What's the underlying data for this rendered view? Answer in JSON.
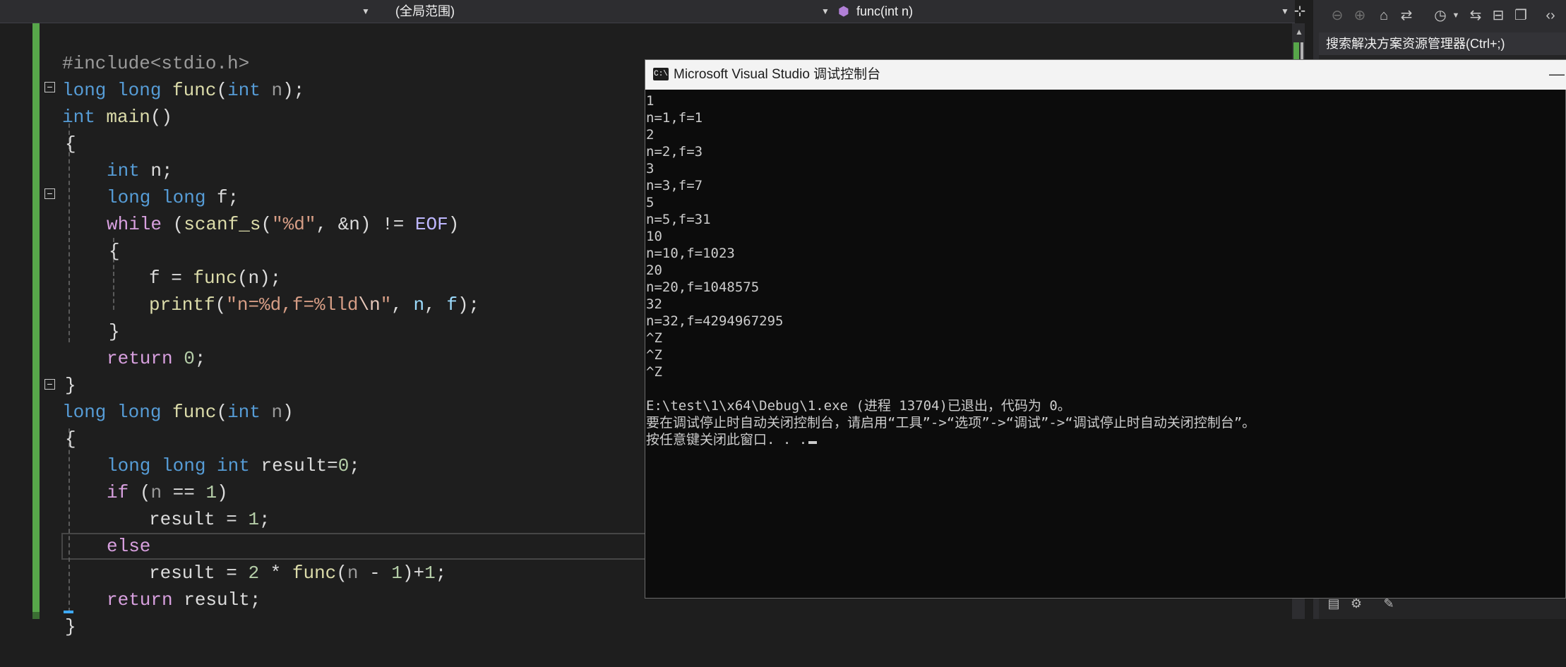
{
  "navbar": {
    "scope_dropdown": "(全局范围)",
    "member_dropdown": "func(int n)"
  },
  "code": {
    "lines": [
      [
        "#include<stdio.h>"
      ],
      [
        "long",
        " long",
        " func",
        "(",
        "int",
        " n",
        ");"
      ],
      [
        "int",
        " main",
        "()"
      ],
      [
        "{"
      ],
      [
        "int",
        " n",
        ";"
      ],
      [
        "long",
        " long",
        " f",
        ";"
      ],
      [
        "while",
        " (",
        "scanf_s",
        "(",
        "\"%d\"",
        ", &",
        "n",
        ") != ",
        "EOF",
        ")"
      ],
      [
        "{"
      ],
      [
        "f",
        " = ",
        "func",
        "(",
        "n",
        ");"
      ],
      [
        "printf",
        "(",
        "\"n=%d,f=%lld",
        "\\n",
        "\"",
        ", ",
        "n",
        ", ",
        "f",
        ");"
      ],
      [
        "}"
      ],
      [
        "return",
        " ",
        "0",
        ";"
      ],
      [
        "}"
      ],
      [
        "long",
        " long",
        " func",
        "(",
        "int",
        " n",
        ")"
      ],
      [
        "{"
      ],
      [
        "long",
        " long",
        " int",
        " result",
        "=",
        "0",
        ";"
      ],
      [
        "if",
        " (",
        "n",
        " == ",
        "1",
        ")"
      ],
      [
        "result",
        " = ",
        "1",
        ";"
      ],
      [
        "else"
      ],
      [
        "result",
        " = ",
        "2",
        " * ",
        "func",
        "(",
        "n",
        " - ",
        "1",
        ")+",
        "1",
        ";"
      ],
      [
        "return",
        " result",
        ";"
      ],
      [
        "}"
      ]
    ]
  },
  "solution_explorer": {
    "search_placeholder": "搜索解决方案资源管理器(Ctrl+;)"
  },
  "console": {
    "title": "Microsoft Visual Studio 调试控制台",
    "icon_label": "C:\\",
    "lines": [
      "1",
      "n=1,f=1",
      "2",
      "n=2,f=3",
      "3",
      "n=3,f=7",
      "5",
      "n=5,f=31",
      "10",
      "n=10,f=1023",
      "20",
      "n=20,f=1048575",
      "32",
      "n=32,f=4294967295",
      "^Z",
      "^Z",
      "^Z",
      "",
      "E:\\test\\1\\x64\\Debug\\1.exe (进程 13704)已退出，代码为 0。",
      "要在调试停止时自动关闭控制台，请启用“工具”->“选项”->“调试”->“调试停止时自动关闭控制台”。",
      "按任意键关闭此窗口. . ."
    ]
  },
  "icons": {
    "back": "back-arrow-icon",
    "forward": "forward-arrow-icon",
    "home": "home-icon",
    "vs": "visual-studio-switch-icon",
    "history": "history-clock-icon",
    "sync": "sync-arrows-icon",
    "collapse": "collapse-all-icon",
    "copy": "copy-icon",
    "split": "split-window-icon"
  },
  "colors": {
    "keyword": "#569cd6",
    "control": "#d8a0df",
    "function": "#dcdcaa",
    "string": "#d69d85",
    "number": "#b5cea8",
    "variable": "#9cdcfe",
    "change_bar": "#57a64a"
  }
}
